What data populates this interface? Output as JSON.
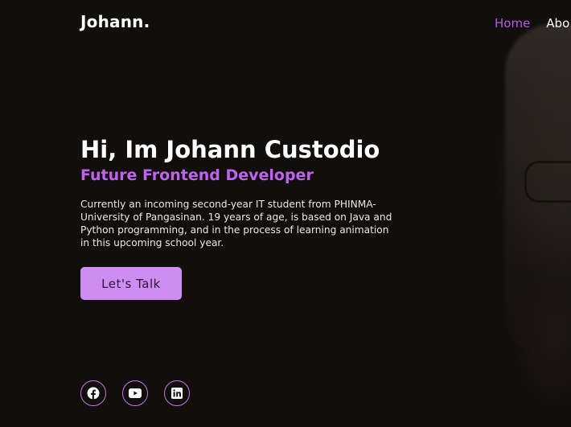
{
  "header": {
    "logo": "Johann.",
    "nav": [
      {
        "label": "Home",
        "active": true
      },
      {
        "label": "Abo"
      }
    ]
  },
  "hero": {
    "title": "Hi, Im Johann Custodio",
    "subtitle": "Future Frontend Developer",
    "description": "Currently an incoming second-year IT student from PHINMA-University of Pangasinan. 19 years of age, is based on Java and Python programming, and in the process of learning animation in this upcoming school year.",
    "cta_label": "Let's Talk"
  },
  "socials": [
    {
      "icon": "facebook-icon"
    },
    {
      "icon": "youtube-icon"
    },
    {
      "icon": "linkedin-icon"
    }
  ],
  "colors": {
    "background": "#120e0c",
    "accent": "#c061f2",
    "button": "#cf8cf3",
    "nav_active": "#b25ce8"
  }
}
